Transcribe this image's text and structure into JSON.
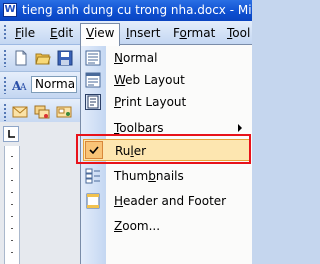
{
  "window": {
    "title": "tieng anh dung cu trong nha.docx - Microsoft Word",
    "app_icon_letter": "W"
  },
  "menubar": {
    "items": [
      {
        "label": "File",
        "accel": "F",
        "rest": "ile"
      },
      {
        "label": "Edit",
        "accel": "E",
        "rest": "dit"
      },
      {
        "label": "View",
        "accel": "V",
        "rest": "iew"
      },
      {
        "label": "Insert",
        "accel": "I",
        "rest": "nsert"
      },
      {
        "label": "Format",
        "accel": "o",
        "pre": "F",
        "rest": "rmat"
      },
      {
        "label": "Tools",
        "accel": "T",
        "rest": "ool"
      }
    ]
  },
  "formatting_toolbar": {
    "style_value": "Normal"
  },
  "view_menu": {
    "items": [
      {
        "label": "Normal",
        "accel": "N",
        "rest": "ormal",
        "icon": "normal-view-icon"
      },
      {
        "label": "Web Layout",
        "accel": "W",
        "rest": "eb Layout",
        "icon": "web-layout-icon"
      },
      {
        "label": "Print Layout",
        "accel": "P",
        "rest": "rint Layout",
        "icon": "print-layout-icon"
      },
      {
        "label": "Toolbars",
        "accel": "T",
        "rest": "oolbars",
        "icon": "",
        "submenu": true
      },
      {
        "label": "Ruler",
        "accel": "l",
        "pre": "Ru",
        "rest": "er",
        "icon": "checkmark-icon",
        "checked": true,
        "highlighted": true
      },
      {
        "label": "Thumbnails",
        "accel": "b",
        "pre": "Thum",
        "rest": "nails",
        "icon": "thumbnails-icon"
      },
      {
        "label": "Header and Footer",
        "accel": "H",
        "rest": "eader and Footer",
        "icon": "header-footer-icon"
      },
      {
        "label": "Zoom...",
        "accel": "Z",
        "rest": "oom...",
        "icon": ""
      }
    ],
    "expand_glyph": "»"
  },
  "colors": {
    "title_bar": "#0d4ed0",
    "menu_highlight": "#fde6b0",
    "highlight_border": "#e8a23a",
    "annotation_red": "#e8121a"
  }
}
